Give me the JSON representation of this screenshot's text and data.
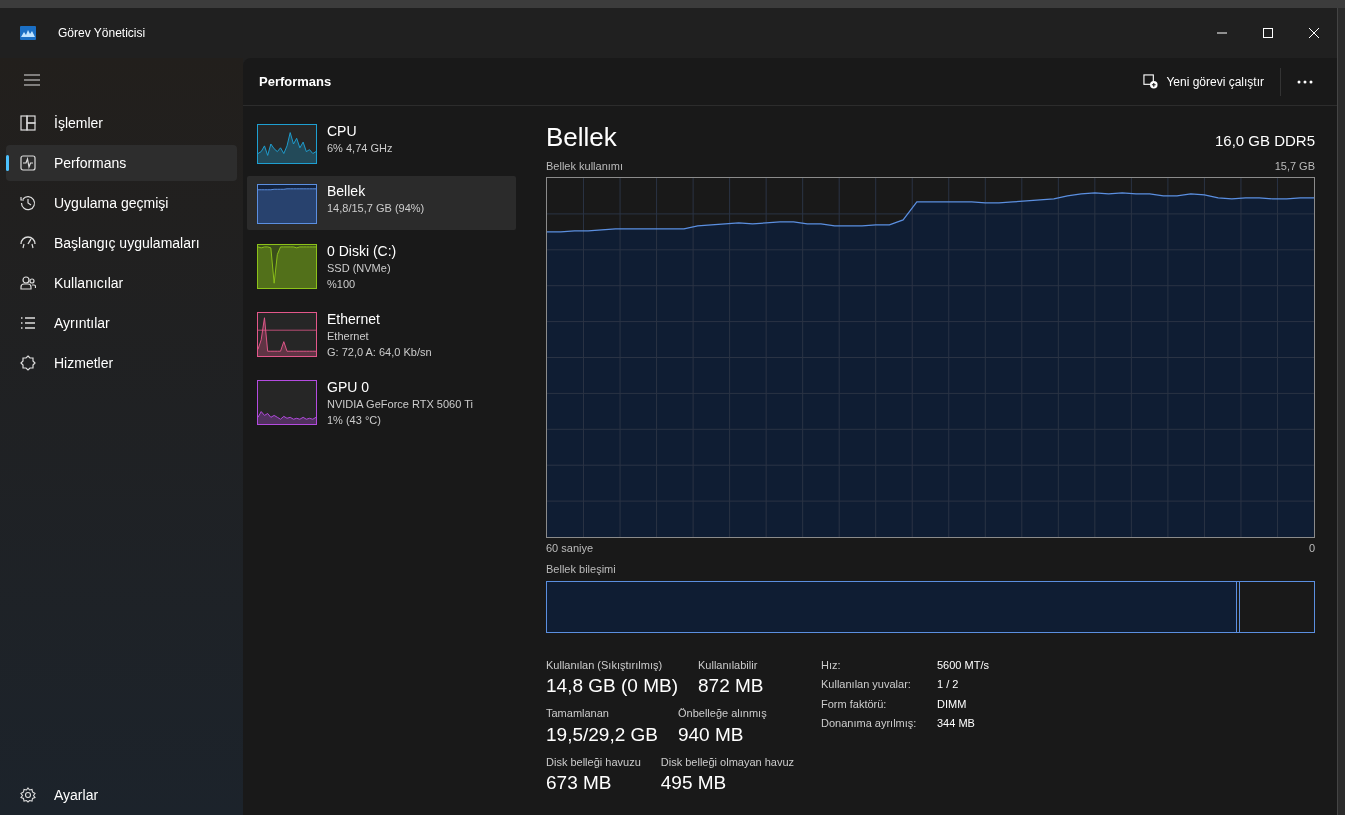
{
  "window": {
    "title": "Görev Yöneticisi"
  },
  "sidebar": {
    "items": [
      {
        "kind": "processes",
        "label": "İşlemler",
        "selected": false
      },
      {
        "kind": "performance",
        "label": "Performans",
        "selected": true
      },
      {
        "kind": "history",
        "label": "Uygulama geçmişi",
        "selected": false
      },
      {
        "kind": "startup",
        "label": "Başlangıç uygulamaları",
        "selected": false
      },
      {
        "kind": "users",
        "label": "Kullanıcılar",
        "selected": false
      },
      {
        "kind": "details",
        "label": "Ayrıntılar",
        "selected": false
      },
      {
        "kind": "services",
        "label": "Hizmetler",
        "selected": false
      }
    ],
    "settings": {
      "label": "Ayarlar"
    }
  },
  "header": {
    "title": "Performans",
    "new_task": "Yeni görevi çalıştır"
  },
  "devices": [
    {
      "kind": "cpu",
      "name": "CPU",
      "lines": [
        "6%  4,74 GHz"
      ],
      "color": "#1e9fd1",
      "selected": false
    },
    {
      "kind": "memory",
      "name": "Bellek",
      "lines": [
        "14,8/15,7 GB (94%)"
      ],
      "color": "#5b8fe0",
      "selected": true
    },
    {
      "kind": "disk",
      "name": "0 Diski (C:)",
      "lines": [
        "SSD (NVMe)",
        "%100"
      ],
      "color": "#8cc21a",
      "selected": false
    },
    {
      "kind": "ethernet",
      "name": "Ethernet",
      "lines": [
        "Ethernet",
        "G: 72,0 A: 64,0 Kb/sn"
      ],
      "color": "#e3578a",
      "selected": false
    },
    {
      "kind": "gpu",
      "name": "GPU 0",
      "lines": [
        "NVIDIA GeForce RTX 5060 Ti",
        "1%  (43 °C)"
      ],
      "color": "#b44be0",
      "selected": false
    }
  ],
  "detail": {
    "title": "Bellek",
    "capacity": "16,0 GB DDR5",
    "usage_label": "Bellek kullanımı",
    "usage_max": "15,7 GB",
    "x_start": "60 saniye",
    "x_end": "0",
    "composition": {
      "label": "Bellek bileşimi",
      "level": 0.9
    },
    "stats": [
      [
        {
          "label": "Kullanılan (Sıkıştırılmış)",
          "value": "14,8 GB (0 MB)"
        },
        {
          "label": "Kullanılabilir",
          "value": "872 MB"
        }
      ],
      [
        {
          "label": "Tamamlanan",
          "value": "19,5/29,2 GB"
        },
        {
          "label": "Önbelleğe alınmış",
          "value": "940 MB"
        }
      ],
      [
        {
          "label": "Disk belleği havuzu",
          "value": "673 MB"
        },
        {
          "label": "Disk belleği olmayan havuz",
          "value": "495 MB"
        }
      ]
    ],
    "properties": [
      {
        "label": "Hız:",
        "value": "5600 MT/s"
      },
      {
        "label": "Kullanılan yuvalar:",
        "value": "1 / 2"
      },
      {
        "label": "Form faktörü:",
        "value": "DIMM"
      },
      {
        "label": "Donanıma ayrılmış:",
        "value": "344 MB"
      }
    ]
  }
}
